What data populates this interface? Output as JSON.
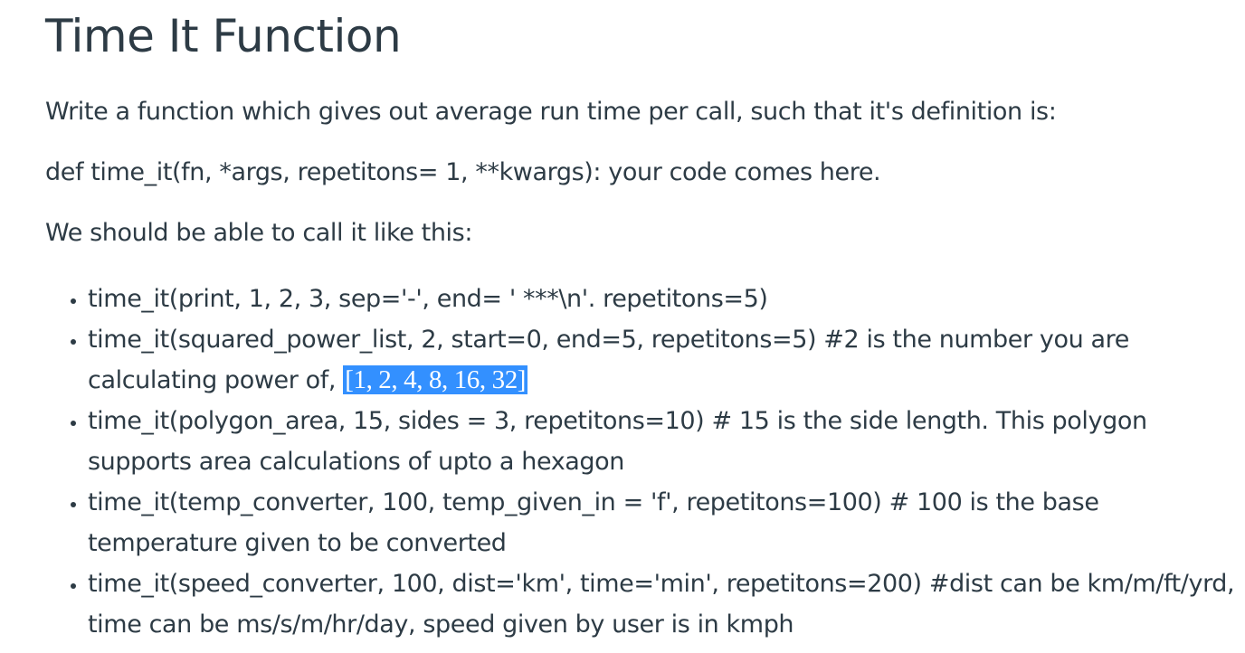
{
  "title": "Time It Function",
  "paragraphs": {
    "intro": "Write a function which gives out average run time per call, such that it's definition is:",
    "signature": "def time_it(fn, *args, repetitons= 1, **kwargs): your code comes here.",
    "call_intro": "We should be able to call it like this:"
  },
  "examples": [
    {
      "text": "time_it(print, 1, 2, 3, sep='-', end= ' ***\\n'. repetitons=5)"
    },
    {
      "text": "time_it(squared_power_list, 2, start=0, end=5, repetitons=5) #2 is the number you are calculating power of, ",
      "selected": "[1, 2, 4, 8, 16, 32]"
    },
    {
      "text": "time_it(polygon_area, 15, sides = 3, repetitons=10) # 15 is the side length. This polygon supports area calculations of upto a hexagon"
    },
    {
      "text": "time_it(temp_converter, 100, temp_given_in = 'f', repetitons=100) # 100 is the base temperature given to be converted"
    },
    {
      "text": "time_it(speed_converter, 100, dist='km', time='min', repetitons=200) #dist can be km/m/ft/yrd, time can be ms/s/m/hr/day, speed given by user is in kmph"
    }
  ],
  "colors": {
    "text": "#2d3b45",
    "selection_bg": "#3390ff",
    "selection_text": "#ffffff"
  }
}
